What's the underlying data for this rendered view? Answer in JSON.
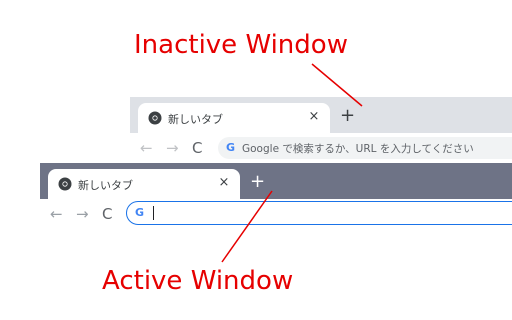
{
  "annotations": {
    "inactive_label": "Inactive Window",
    "active_label": "Active Window",
    "color": "#e60000"
  },
  "inactive_window": {
    "tab_title": "新しいタブ",
    "tab_close": "×",
    "new_tab": "+",
    "omnibox_placeholder": "Google で検索するか、URL を入力してください",
    "tabstrip_color": "#dee1e6"
  },
  "active_window": {
    "tab_title": "新しいタブ",
    "tab_close": "×",
    "new_tab": "+",
    "omnibox_value": "",
    "tabstrip_color": "#6e7386",
    "focus_color": "#1a73e8"
  },
  "toolbar": {
    "back": "←",
    "forward": "→",
    "reload": "C",
    "search_logo": "G"
  }
}
